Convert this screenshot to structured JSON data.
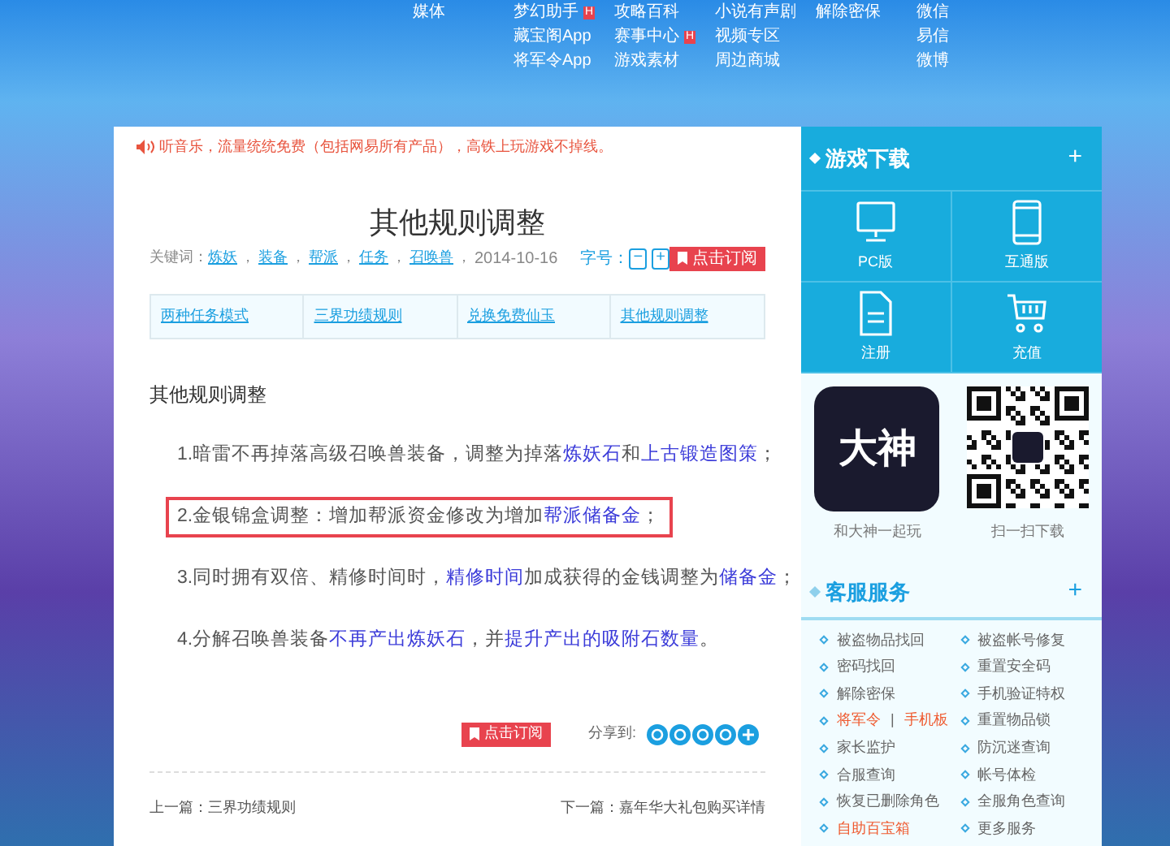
{
  "nav": {
    "columns": [
      [
        {
          "label": "媒体"
        }
      ],
      [
        {
          "label": "梦幻助手",
          "badge": "H"
        },
        {
          "label": "藏宝阁App"
        },
        {
          "label": "将军令App"
        }
      ],
      [
        {
          "label": "攻略百科"
        },
        {
          "label": "赛事中心",
          "badge": "H"
        },
        {
          "label": "游戏素材"
        }
      ],
      [
        {
          "label": "小说有声剧"
        },
        {
          "label": "视频专区"
        },
        {
          "label": "周边商城"
        }
      ],
      [
        {
          "label": "解除密保"
        }
      ],
      [
        {
          "label": "微信"
        },
        {
          "label": "易信"
        },
        {
          "label": "微博"
        }
      ]
    ]
  },
  "notice": "听音乐，流量统统免费（包括网易所有产品），高铁上玩游戏不掉线。",
  "article": {
    "title": "其他规则调整",
    "keywords_label": "关键词：",
    "keywords": [
      {
        "label": "炼妖",
        "sep": "，"
      },
      {
        "label": "装备",
        "sep": "，"
      },
      {
        "label": "帮派",
        "sep": "，"
      },
      {
        "label": "任务",
        "sep": "，"
      },
      {
        "label": "召唤兽",
        "sep": "，"
      }
    ],
    "date": "2014-10-16",
    "font_size_label": "字号：",
    "font_minus": "−",
    "font_plus": "+",
    "subscribe": "点击订阅",
    "tabs": [
      {
        "label": "两种任务模式",
        "selected": false
      },
      {
        "label": "三界功绩规则",
        "selected": false
      },
      {
        "label": "兑换免费仙玉",
        "selected": false
      },
      {
        "label": "其他规则调整",
        "selected": false
      }
    ],
    "heading": "其他规则调整",
    "items": [
      {
        "highlighted": false,
        "segments": [
          {
            "text": "1.暗雷不再掉落高级召唤兽装备，调整为掉落",
            "link": false
          },
          {
            "text": "炼妖石",
            "link": true
          },
          {
            "text": "和",
            "link": false
          },
          {
            "text": "上古锻造图策",
            "link": true
          },
          {
            "text": "；",
            "link": false
          }
        ]
      },
      {
        "highlighted": true,
        "segments": [
          {
            "text": "2.金银锦盒调整：增加帮派资金修改为增加",
            "link": false
          },
          {
            "text": "帮派储备金",
            "link": true
          },
          {
            "text": "；",
            "link": false
          }
        ]
      },
      {
        "highlighted": false,
        "segments": [
          {
            "text": "3.同时拥有双倍、精修时间时，",
            "link": false
          },
          {
            "text": "精修时间",
            "link": true
          },
          {
            "text": "加成获得的金钱调整为",
            "link": false
          },
          {
            "text": "储备金",
            "link": true
          },
          {
            "text": "；",
            "link": false
          }
        ]
      },
      {
        "highlighted": false,
        "segments": [
          {
            "text": "4.分解召唤兽装备",
            "link": false
          },
          {
            "text": "不再产出炼妖石",
            "link": true
          },
          {
            "text": "，并",
            "link": false
          },
          {
            "text": "提升产出的吸附石数量",
            "link": true
          },
          {
            "text": "。",
            "link": false
          }
        ]
      }
    ],
    "bottom_subscribe": "点击订阅",
    "share_label": "分享到:",
    "prev": "上一篇：三界功绩规则",
    "next": "下一篇：嘉年华大礼包购买详情"
  },
  "sidebar": {
    "download_title": "游戏下载",
    "download_toggle": "+",
    "downloads": [
      {
        "label": "PC版",
        "kind": "monitor"
      },
      {
        "label": "互通版",
        "kind": "phone"
      },
      {
        "label": "注册",
        "kind": "document"
      },
      {
        "label": "充值",
        "kind": "cart"
      }
    ],
    "app_logo_text": "大神",
    "app_label": "和大神一起玩",
    "qr_label": "扫一扫下载",
    "service_title": "客服服务",
    "service_toggle": "+",
    "services": [
      {
        "labels": [
          "被盗物品找回"
        ],
        "highlight": false
      },
      {
        "labels": [
          "被盗帐号修复"
        ],
        "highlight": false
      },
      {
        "labels": [
          "密码找回"
        ],
        "highlight": false
      },
      {
        "labels": [
          "重置安全码"
        ],
        "highlight": false
      },
      {
        "labels": [
          "解除密保"
        ],
        "highlight": false
      },
      {
        "labels": [
          "手机验证特权"
        ],
        "highlight": false
      },
      {
        "labels": [
          "将军令",
          "手机板"
        ],
        "separator": "|",
        "highlight": true
      },
      {
        "labels": [
          "重置物品锁"
        ],
        "highlight": false
      },
      {
        "labels": [
          "家长监护"
        ],
        "highlight": false
      },
      {
        "labels": [
          "防沉迷查询"
        ],
        "highlight": false
      },
      {
        "labels": [
          "合服查询"
        ],
        "highlight": false
      },
      {
        "labels": [
          "帐号体检"
        ],
        "highlight": false
      },
      {
        "labels": [
          "恢复已删除角色"
        ],
        "highlight": false
      },
      {
        "labels": [
          "全服角色查询"
        ],
        "highlight": false
      },
      {
        "labels": [
          "自助百宝箱"
        ],
        "highlight": true
      },
      {
        "labels": [
          "更多服务"
        ],
        "highlight": false
      }
    ]
  }
}
